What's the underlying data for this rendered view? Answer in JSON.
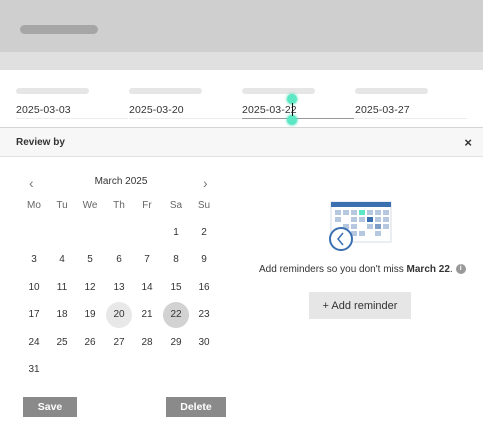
{
  "date_fields": [
    {
      "value": "2025-03-03"
    },
    {
      "value": "2025-03-20"
    },
    {
      "value": "2025-03-22"
    },
    {
      "value": "2025-03-27"
    }
  ],
  "popup": {
    "title": "Review by",
    "close_label": "×"
  },
  "calendar": {
    "month_label": "March 2025",
    "prev_label": "‹",
    "next_label": "›",
    "weekdays": [
      "Mo",
      "Tu",
      "We",
      "Th",
      "Fr",
      "Sa",
      "Su"
    ],
    "weeks": [
      [
        "",
        "",
        "",
        "",
        "",
        "1",
        "2"
      ],
      [
        "3",
        "4",
        "5",
        "6",
        "7",
        "8",
        "9"
      ],
      [
        "10",
        "11",
        "12",
        "13",
        "14",
        "15",
        "16"
      ],
      [
        "17",
        "18",
        "19",
        "20",
        "21",
        "22",
        "23"
      ],
      [
        "24",
        "25",
        "26",
        "27",
        "28",
        "29",
        "30"
      ],
      [
        "31",
        "",
        "",
        "",
        "",
        "",
        ""
      ]
    ],
    "today": "20",
    "selected": "22"
  },
  "reminder": {
    "text_prefix": "Add reminders so you don't miss ",
    "date_bold": "March 22",
    "text_suffix": ".",
    "info_icon": "i",
    "add_button": "+ Add reminder"
  },
  "actions": {
    "save_label": "Save",
    "delete_label": "Delete"
  },
  "colors": {
    "accent_calendar": "#3a6fb0",
    "caret_handle": "#5ce8c4"
  }
}
